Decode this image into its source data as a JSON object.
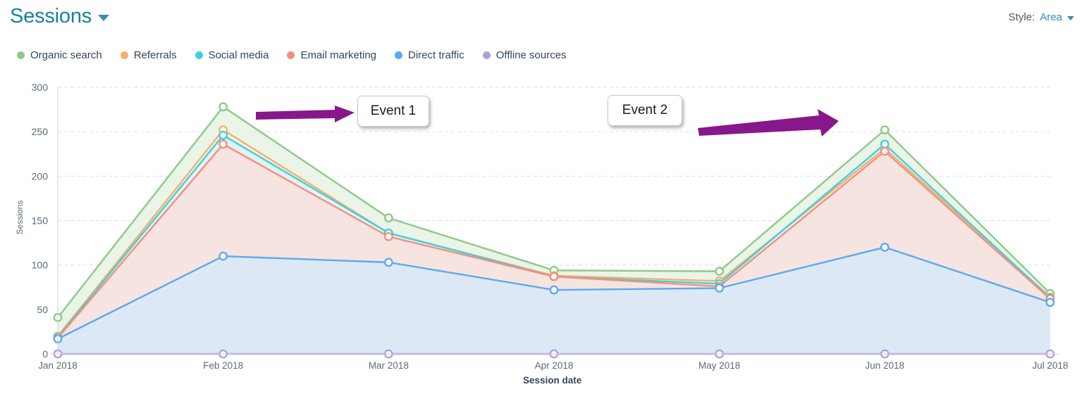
{
  "header": {
    "title": "Sessions",
    "title_caret_icon": "chevron-down-icon",
    "style_label": "Style:",
    "style_value": "Area",
    "style_caret_icon": "chevron-down-icon"
  },
  "legend": [
    {
      "label": "Organic search",
      "color": "#8ec98b"
    },
    {
      "label": "Referrals",
      "color": "#f5b06a"
    },
    {
      "label": "Social media",
      "color": "#3fd0dd"
    },
    {
      "label": "Email marketing",
      "color": "#f78d7e"
    },
    {
      "label": "Direct traffic",
      "color": "#5aa9f3"
    },
    {
      "label": "Offline sources",
      "color": "#b39ddb"
    }
  ],
  "annotations": [
    {
      "label": "Event 1",
      "arrow": "left-arrow-icon",
      "arrow_color": "#87188b"
    },
    {
      "label": "Event 2",
      "arrow": "right-arrow-icon",
      "arrow_color": "#87188b"
    }
  ],
  "chart_data": {
    "type": "area",
    "title": "Sessions",
    "xlabel": "Session date",
    "ylabel": "Sessions",
    "ylim": [
      0,
      300
    ],
    "yticks": [
      0,
      50,
      100,
      150,
      200,
      250,
      300
    ],
    "grid": true,
    "legend_position": "top-left",
    "stacked": false,
    "categories": [
      "Jan 2018",
      "Feb 2018",
      "Mar 2018",
      "Apr 2018",
      "May 2018",
      "Jun 2018",
      "Jul 2018"
    ],
    "series": [
      {
        "name": "Organic search",
        "color": "#8ec98b",
        "fill": "#e4f1e0",
        "values": [
          41,
          278,
          153,
          94,
          93,
          252,
          68
        ]
      },
      {
        "name": "Referrals",
        "color": "#f5b06a",
        "fill": "#fdf0e2",
        "values": [
          20,
          252,
          136,
          88,
          82,
          231,
          64
        ]
      },
      {
        "name": "Social media",
        "color": "#3fd0dd",
        "fill": "#d9f4f7",
        "values": [
          19,
          246,
          136,
          87,
          79,
          236,
          63
        ]
      },
      {
        "name": "Email marketing",
        "color": "#f78d7e",
        "fill": "#fbdfd9",
        "values": [
          18,
          236,
          132,
          87,
          76,
          228,
          62
        ]
      },
      {
        "name": "Direct traffic",
        "color": "#5aa9f3",
        "fill": "#d6e9fb",
        "values": [
          17,
          110,
          103,
          72,
          74,
          120,
          58
        ]
      },
      {
        "name": "Offline sources",
        "color": "#b39ddb",
        "fill": "#ece4f6",
        "values": [
          0,
          0,
          0,
          0,
          0,
          0,
          0
        ]
      }
    ],
    "annotations": [
      {
        "label": "Event 1",
        "arrow_direction": "left"
      },
      {
        "label": "Event 2",
        "arrow_direction": "right"
      }
    ]
  }
}
